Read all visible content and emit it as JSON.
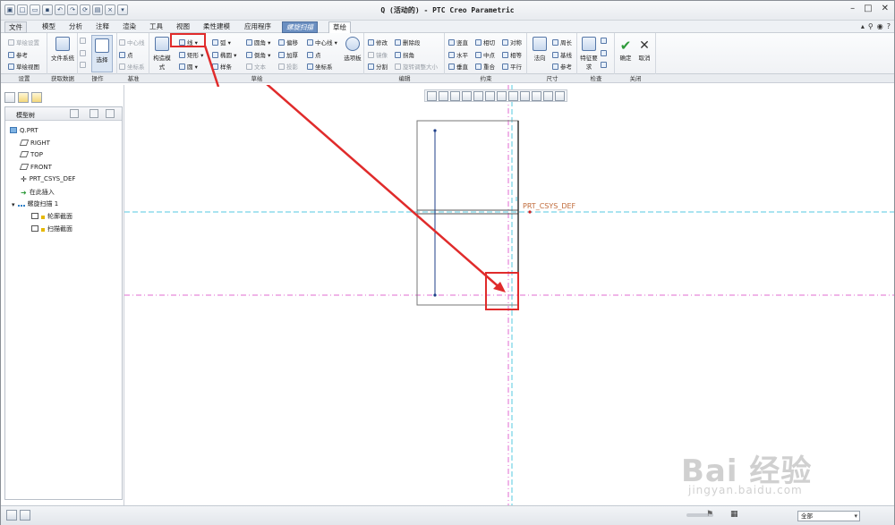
{
  "window": {
    "title": "Q (活动的) - PTC Creo Parametric"
  },
  "tabs": [
    "文件",
    "模型",
    "分析",
    "注释",
    "渲染",
    "工具",
    "视图",
    "柔性建模",
    "应用程序",
    "螺旋扫描",
    "草绘"
  ],
  "ribbon": {
    "setup": {
      "items": [
        "草绘设置",
        "参考",
        "草绘视图"
      ],
      "label": "设置"
    },
    "get_data": {
      "big": "文件系统",
      "label": "获取数据"
    },
    "operations": {
      "big": "选择",
      "label": "操作"
    },
    "datum": {
      "items": [
        "中心线",
        "点",
        "坐标系"
      ],
      "label": "基准"
    },
    "sketching": {
      "construction_mode": "构造模式",
      "line": "线",
      "arc": "弧",
      "fillet": "圆角",
      "offset": "偏移",
      "centerline": "中心线",
      "rectangle": "矩形",
      "ellipse": "椭圆",
      "chamfer": "倒角",
      "thicken": "加厚",
      "point": "点",
      "circle": "圆",
      "spline": "样条",
      "text": "文本",
      "project": "投影",
      "csys": "坐标系",
      "palette": "选项板",
      "label": "草绘"
    },
    "editing": {
      "items": [
        "修改",
        "删除段",
        "镜像",
        "拐角",
        "分割",
        "旋转调整大小"
      ],
      "label": "编辑"
    },
    "constrain": {
      "items": [
        "竖直",
        "相切",
        "对称",
        "水平",
        "中点",
        "相等",
        "垂直",
        "重合",
        "平行"
      ],
      "label": "约束"
    },
    "dimension": {
      "big": "法向",
      "items": [
        "周长",
        "基线",
        "参考"
      ],
      "label": "尺寸"
    },
    "inspect": {
      "big": "特征要求",
      "label": "检查"
    },
    "close": {
      "ok": "确定",
      "cancel": "取消",
      "label": "关闭"
    }
  },
  "model_tree": {
    "header": "模型树",
    "items": [
      "Q.PRT",
      "RIGHT",
      "TOP",
      "FRONT",
      "PRT_CSYS_DEF",
      "在此插入",
      "螺旋扫描 1",
      "轮廓截面",
      "扫描截面"
    ]
  },
  "canvas": {
    "csys_label": "PRT_CSYS_DEF"
  },
  "statusbar": {
    "filter": "全部"
  },
  "watermark": {
    "brand": "Bai 经验",
    "url": "jingyan.baidu.com"
  },
  "colors": {
    "highlight_tab": "#6b8fc1",
    "annotation_red": "#e02b2b",
    "axis_cyan": "#56c8e0",
    "axis_magenta": "#e06bd0"
  }
}
